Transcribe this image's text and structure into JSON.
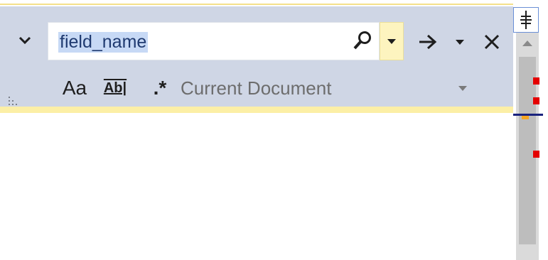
{
  "find": {
    "search_value": "field_name",
    "scope": "Current Document",
    "match_case_label": "Aa",
    "whole_word_label": "Ab|",
    "regex_label": ".*"
  },
  "icons": {
    "expand": "chevron-down-icon",
    "search": "search-icon",
    "history": "dropdown-arrow-icon",
    "find_next": "arrow-right-icon",
    "find_next_options": "dropdown-arrow-icon",
    "close": "close-icon",
    "splitter": "window-splitter-icon",
    "scroll_up": "scroll-up-icon"
  },
  "colors": {
    "panel_bg": "#cfd6e5",
    "selection": "#c7d9f5",
    "search_text": "#1f3a70",
    "history_bg": "#fdf4bf",
    "scope_text": "#6d6d6d",
    "marker_red": "#e40000",
    "caret_blue": "#1a237e"
  }
}
